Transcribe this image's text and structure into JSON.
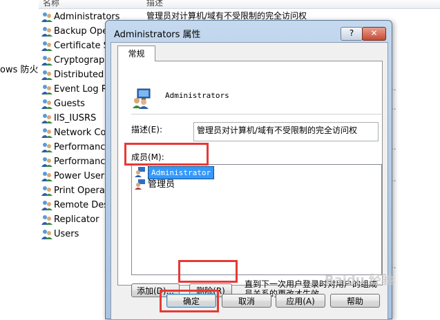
{
  "background": {
    "header": {
      "name_col": "名称",
      "desc_col": "描述"
    },
    "left_text": "ows 防火",
    "first_desc": "管理员对计算机/域有不受限制的完全访问权",
    "items": [
      "Administrators",
      "Backup Oper",
      "Certificate Se",
      "Cryptograph",
      "Distributed C",
      "Event Log Re",
      "Guests",
      "IIS_IUSRS",
      "Network Cor",
      "Performance",
      "Performance",
      "Power Users",
      "Print Operato",
      "Remote Desk",
      "Replicator",
      "Users"
    ]
  },
  "dialog": {
    "title": "Administrators 属性",
    "help_glyph": "?",
    "close_glyph": "✕",
    "tab": "常规",
    "group_name": "Administrators",
    "desc_label": "描述(E):",
    "desc_value": "管理员对计算机/域有不受限制的完全访问权",
    "members_label": "成员(M):",
    "members": [
      "Administrator",
      "管理员"
    ],
    "add_button": "添加(D)...",
    "delete_button": "删除(R)",
    "note": "直到下一次用户登录时对用户的组成员关系的更改才生效。",
    "ok_button": "确定",
    "cancel_button": "取消",
    "apply_button": "应用(A)",
    "help_button": "帮助"
  },
  "watermark": "Baidu 经验",
  "colors": {
    "highlight": "#e53935",
    "selection": "#3399ff"
  }
}
